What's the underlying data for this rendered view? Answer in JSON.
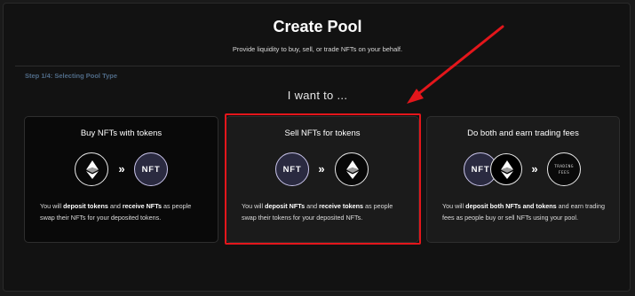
{
  "header": {
    "title": "Create Pool",
    "subtitle": "Provide liquidity to buy, sell, or trade NFTs on your behalf."
  },
  "step_label": "Step 1/4: Selecting Pool Type",
  "prompt": "I want to ...",
  "cards": [
    {
      "title": "Buy NFTs with tokens",
      "icons": [
        "ethereum-icon",
        "double-chevron-right-icon",
        "nft-badge"
      ],
      "nft_badge": "NFT",
      "desc_parts": [
        "You will ",
        "deposit tokens",
        " and ",
        "receive NFTs",
        " as people swap their NFTs for your deposited tokens."
      ]
    },
    {
      "title": "Sell NFTs for tokens",
      "icons": [
        "nft-badge",
        "double-chevron-right-icon",
        "ethereum-icon"
      ],
      "nft_badge": "NFT",
      "desc_parts": [
        "You will ",
        "deposit NFTs",
        " and ",
        "receive tokens",
        " as people swap their tokens for your deposited NFTs."
      ],
      "highlighted": true
    },
    {
      "title": "Do both and earn trading fees",
      "icons": [
        "nft-badge",
        "ethereum-icon",
        "double-chevron-right-icon",
        "trading-fees-badge"
      ],
      "nft_badge": "NFT",
      "fees_badge_line1": "TRADING",
      "fees_badge_line2": "FEES",
      "desc_parts": [
        "You will ",
        "deposit both NFTs and tokens",
        " and earn trading fees as people buy or sell NFTs using your pool."
      ]
    }
  ],
  "colors": {
    "background": "#121212",
    "card_background": "#1b1b1b",
    "nft_badge_fill": "#2a2a40",
    "nft_badge_border": "#c9c4ea",
    "step_label": "#4f6a86",
    "annotation_red": "#e3161b"
  },
  "arrow_glyph": "»"
}
